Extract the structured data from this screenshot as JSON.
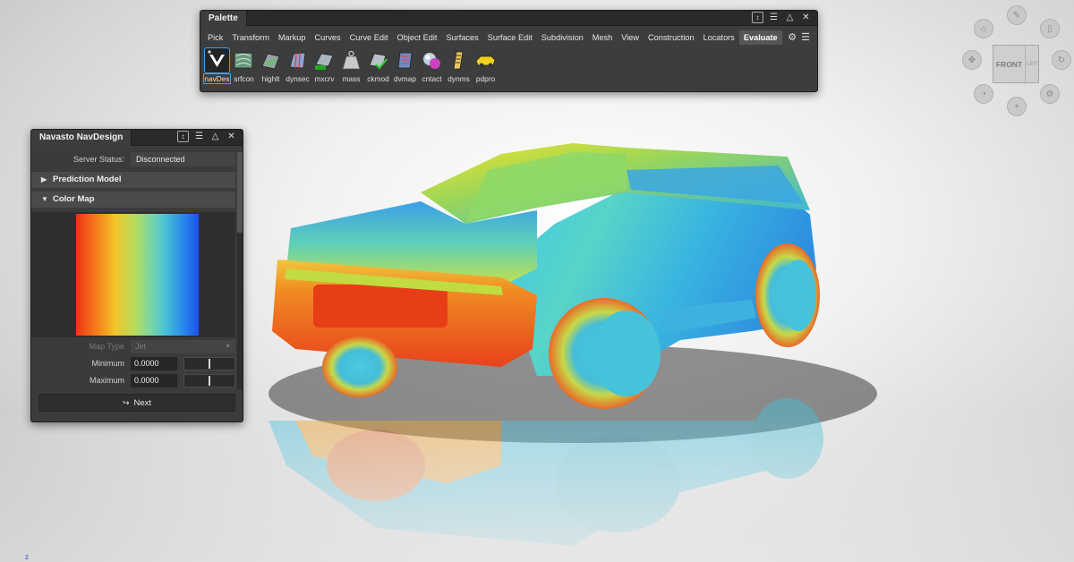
{
  "palette": {
    "title": "Palette",
    "tabs": [
      "Pick",
      "Transform",
      "Markup",
      "Curves",
      "Curve Edit",
      "Object Edit",
      "Surfaces",
      "Surface Edit",
      "Subdivision",
      "Mesh",
      "View",
      "Construction",
      "Locators",
      "Evaluate"
    ],
    "active_tab": "Evaluate",
    "tools": [
      {
        "label": "navDes",
        "icon": "navdesign-logo-icon",
        "selected": true
      },
      {
        "label": "srfcon",
        "icon": "surface-continuity-icon"
      },
      {
        "label": "highlt",
        "icon": "highlight-icon"
      },
      {
        "label": "dynsec",
        "icon": "dynamic-section-icon"
      },
      {
        "label": "mxcrv",
        "icon": "max-curvature-icon"
      },
      {
        "label": "mass",
        "icon": "mass-weight-icon"
      },
      {
        "label": "ckmod",
        "icon": "check-model-icon"
      },
      {
        "label": "dvmap",
        "icon": "deviation-map-icon"
      },
      {
        "label": "cntact",
        "icon": "contact-icon"
      },
      {
        "label": "dynms",
        "icon": "dynamic-measure-icon"
      },
      {
        "label": "pdpro",
        "icon": "product-pro-icon"
      }
    ]
  },
  "navdesign": {
    "title": "Navasto NavDesign",
    "server_status_label": "Server Status:",
    "server_status_value": "Disconnected",
    "section_prediction": "Prediction Model",
    "section_colormap": "Color Map",
    "map_type_label": "Map Type",
    "map_type_value": "Jet",
    "minimum_label": "Minimum",
    "minimum_value": "0.0000",
    "maximum_label": "Maximum",
    "maximum_value": "0.0000",
    "next_label": "Next"
  },
  "viewcube": {
    "front_label": "FRONT",
    "left_label": "LEFT"
  },
  "colors": {
    "accent": "#4a9fe0",
    "panel_bg": "#3b3b3b",
    "jet_red": "#ee3318",
    "jet_blue": "#1d50f0"
  }
}
